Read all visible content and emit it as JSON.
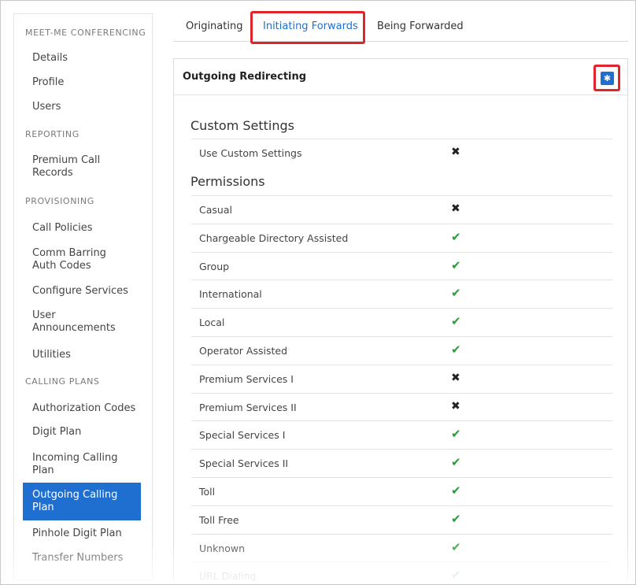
{
  "sidebar": {
    "sections": [
      {
        "label": "MEET-ME CONFERENCING"
      },
      {
        "label": "REPORTING"
      },
      {
        "label": "PROVISIONING"
      },
      {
        "label": "CALLING PLANS"
      }
    ],
    "items": [
      {
        "label": "Details"
      },
      {
        "label": "Profile"
      },
      {
        "label": "Users"
      },
      {
        "label": "Premium Call Records"
      },
      {
        "label": "Call Policies"
      },
      {
        "label": "Comm Barring Auth Codes"
      },
      {
        "label": "Configure Services"
      },
      {
        "label": "User Announcements"
      },
      {
        "label": "Utilities"
      },
      {
        "label": "Authorization Codes"
      },
      {
        "label": "Digit Plan"
      },
      {
        "label": "Incoming Calling Plan"
      },
      {
        "label": "Outgoing Calling Plan",
        "active": true
      },
      {
        "label": "Pinhole Digit Plan"
      },
      {
        "label": "Transfer Numbers"
      }
    ]
  },
  "tabs": [
    {
      "label": "Originating"
    },
    {
      "label": "Initiating Forwards",
      "active": true
    },
    {
      "label": "Being Forwarded"
    }
  ],
  "panel": {
    "title": "Outgoing Redirecting",
    "settings_icon": "gear-icon",
    "custom_settings": {
      "heading": "Custom Settings",
      "rows": [
        {
          "label": "Use Custom Settings",
          "enabled": false
        }
      ]
    },
    "permissions": {
      "heading": "Permissions",
      "rows": [
        {
          "label": "Casual",
          "enabled": false
        },
        {
          "label": "Chargeable Directory Assisted",
          "enabled": true
        },
        {
          "label": "Group",
          "enabled": true
        },
        {
          "label": "International",
          "enabled": true
        },
        {
          "label": "Local",
          "enabled": true
        },
        {
          "label": "Operator Assisted",
          "enabled": true
        },
        {
          "label": "Premium Services I",
          "enabled": false
        },
        {
          "label": "Premium Services II",
          "enabled": false
        },
        {
          "label": "Special Services I",
          "enabled": true
        },
        {
          "label": "Special Services II",
          "enabled": true
        },
        {
          "label": "Toll",
          "enabled": true
        },
        {
          "label": "Toll Free",
          "enabled": true
        },
        {
          "label": "Unknown",
          "enabled": true
        },
        {
          "label": "URL Dialing",
          "enabled": true
        }
      ]
    }
  },
  "colors": {
    "accent": "#1f6fd1",
    "highlight": "#e0242b",
    "check": "#2a9d3a"
  },
  "glyphs": {
    "check": "✔",
    "cross": "✖",
    "gear": "✱"
  }
}
